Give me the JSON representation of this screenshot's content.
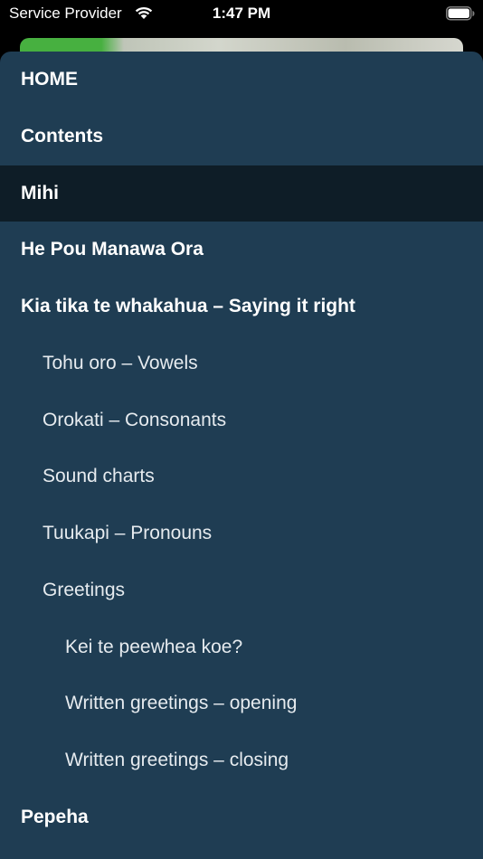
{
  "status_bar": {
    "carrier": "Service Provider",
    "time": "1:47 PM",
    "wifi_icon": "wifi-icon",
    "battery_icon": "battery-icon"
  },
  "colors": {
    "drawer_background": "#1f3d53",
    "selected_background": "#0e1d27",
    "text": "#ffffff"
  },
  "menu": {
    "items": [
      {
        "label": "HOME",
        "level": 0,
        "selected": false
      },
      {
        "label": "Contents",
        "level": 0,
        "selected": false
      },
      {
        "label": "Mihi",
        "level": 0,
        "selected": true
      },
      {
        "label": "He Pou Manawa Ora",
        "level": 0,
        "selected": false
      },
      {
        "label": "Kia tika te whakahua – Saying it right",
        "level": 0,
        "selected": false
      },
      {
        "label": "Tohu oro – Vowels",
        "level": 1,
        "selected": false
      },
      {
        "label": "Orokati – Consonants",
        "level": 1,
        "selected": false
      },
      {
        "label": "Sound charts",
        "level": 1,
        "selected": false
      },
      {
        "label": "Tuukapi – Pronouns",
        "level": 1,
        "selected": false
      },
      {
        "label": "Greetings",
        "level": 1,
        "selected": false
      },
      {
        "label": "Kei te peewhea koe?",
        "level": 2,
        "selected": false
      },
      {
        "label": "Written greetings – opening",
        "level": 2,
        "selected": false
      },
      {
        "label": "Written greetings – closing",
        "level": 2,
        "selected": false
      },
      {
        "label": "Pepeha",
        "level": 0,
        "selected": false
      }
    ]
  }
}
